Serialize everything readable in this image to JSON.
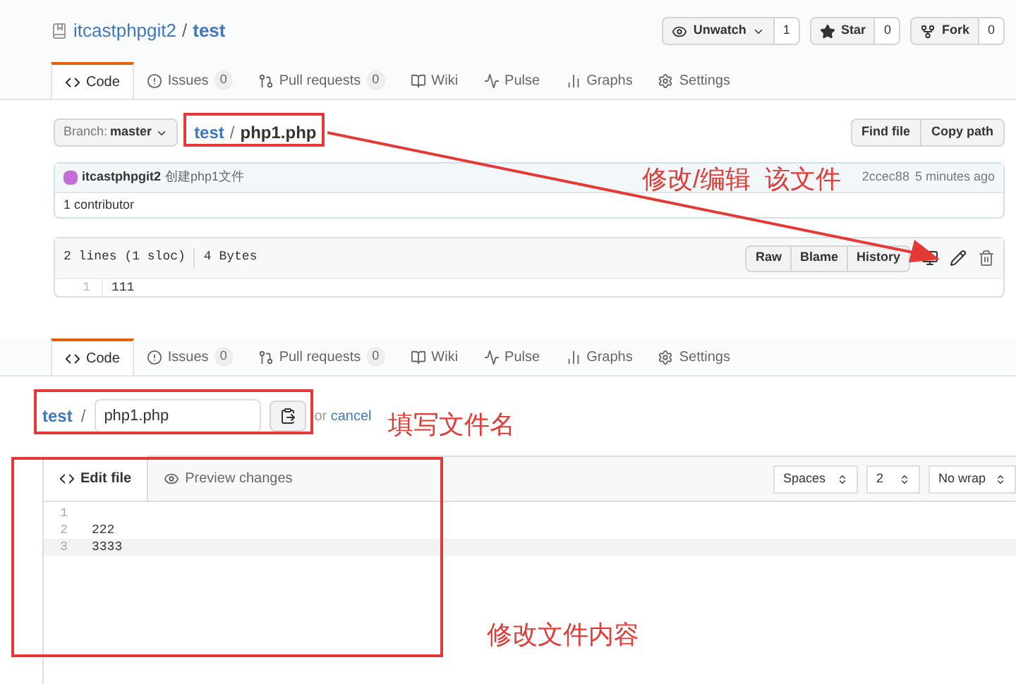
{
  "top_screen": {
    "repo": {
      "owner": "itcastphpgit2",
      "separator": "/",
      "name": "test"
    },
    "actions": [
      {
        "kind": "watch",
        "label": "Unwatch",
        "count": "1"
      },
      {
        "kind": "star",
        "label": "Star",
        "count": "0"
      },
      {
        "kind": "fork",
        "label": "Fork",
        "count": "0"
      }
    ],
    "tabs": [
      {
        "kind": "code",
        "label": "Code",
        "selected": true
      },
      {
        "kind": "issues",
        "label": "Issues",
        "count": "0",
        "selected": false
      },
      {
        "kind": "pulls",
        "label": "Pull requests",
        "count": "0",
        "selected": false
      },
      {
        "kind": "wiki",
        "label": "Wiki",
        "selected": false
      },
      {
        "kind": "pulse",
        "label": "Pulse",
        "selected": false
      },
      {
        "kind": "graphs",
        "label": "Graphs",
        "selected": false
      },
      {
        "kind": "settings",
        "label": "Settings",
        "selected": false
      }
    ],
    "branch": {
      "prefix": "Branch:",
      "name": "master"
    },
    "breadcrumb": {
      "repo": "test",
      "separator": "/",
      "file": "php1.php"
    },
    "file_actions": [
      "Find file",
      "Copy path"
    ],
    "commit": {
      "author": "itcastphpgit2",
      "message": "创建php1文件",
      "sha": "2ccec88",
      "time": "5 minutes ago"
    },
    "contributors": "1 contributor",
    "file_info": {
      "lines": "2 lines (1 sloc)",
      "size": "4 Bytes"
    },
    "view_buttons": [
      "Raw",
      "Blame",
      "History"
    ],
    "code_lines": [
      {
        "number": "1",
        "text": "111"
      }
    ]
  },
  "bottom_screen": {
    "tabs": [
      {
        "kind": "code",
        "label": "Code",
        "selected": true
      },
      {
        "kind": "issues",
        "label": "Issues",
        "count": "0",
        "selected": false
      },
      {
        "kind": "pulls",
        "label": "Pull requests",
        "count": "0",
        "selected": false
      },
      {
        "kind": "wiki",
        "label": "Wiki",
        "selected": false
      },
      {
        "kind": "pulse",
        "label": "Pulse",
        "selected": false
      },
      {
        "kind": "graphs",
        "label": "Graphs",
        "selected": false
      },
      {
        "kind": "settings",
        "label": "Settings",
        "selected": false
      }
    ],
    "path": {
      "repo": "test",
      "separator": "/",
      "filename": "php1.php"
    },
    "cancel": {
      "prefix": "or",
      "link": "cancel"
    },
    "editor_tabs": [
      {
        "kind": "edit",
        "label": "Edit file",
        "selected": true
      },
      {
        "kind": "preview",
        "label": "Preview changes",
        "selected": false
      }
    ],
    "options": [
      "Spaces",
      "2",
      "No wrap"
    ],
    "lines": [
      {
        "number": "1"
      },
      {
        "number": "2",
        "text": "222"
      },
      {
        "number": "3",
        "text": "3333"
      }
    ]
  },
  "annotations": [
    "修改/编辑  该文件",
    "填写文件名",
    "修改文件内容"
  ]
}
